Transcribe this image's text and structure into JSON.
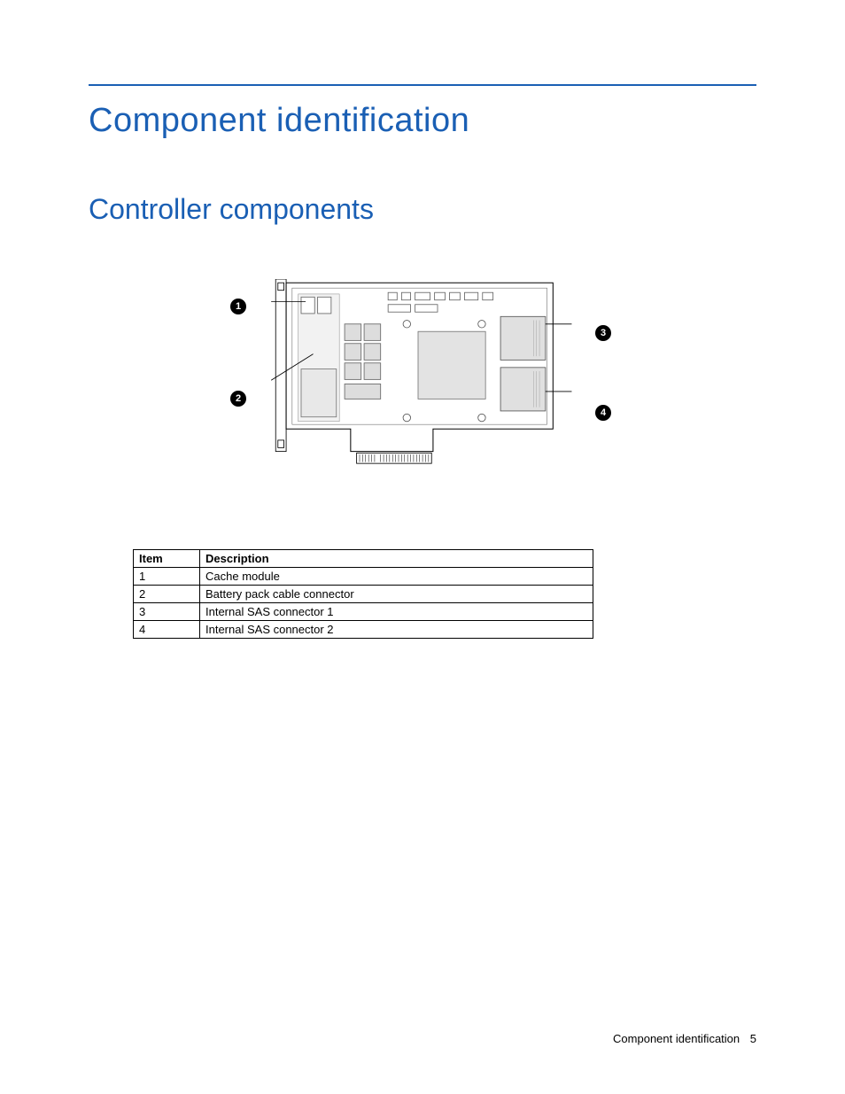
{
  "headings": {
    "h1": "Component identification",
    "h2": "Controller components"
  },
  "diagram": {
    "callouts": [
      "1",
      "2",
      "3",
      "4"
    ]
  },
  "table": {
    "headers": {
      "item": "Item",
      "description": "Description"
    },
    "rows": [
      {
        "item": "1",
        "description": "Cache module"
      },
      {
        "item": "2",
        "description": "Battery pack cable connector"
      },
      {
        "item": "3",
        "description": "Internal SAS connector 1"
      },
      {
        "item": "4",
        "description": "Internal SAS connector 2"
      }
    ]
  },
  "footer": {
    "section": "Component identification",
    "page": "5"
  }
}
